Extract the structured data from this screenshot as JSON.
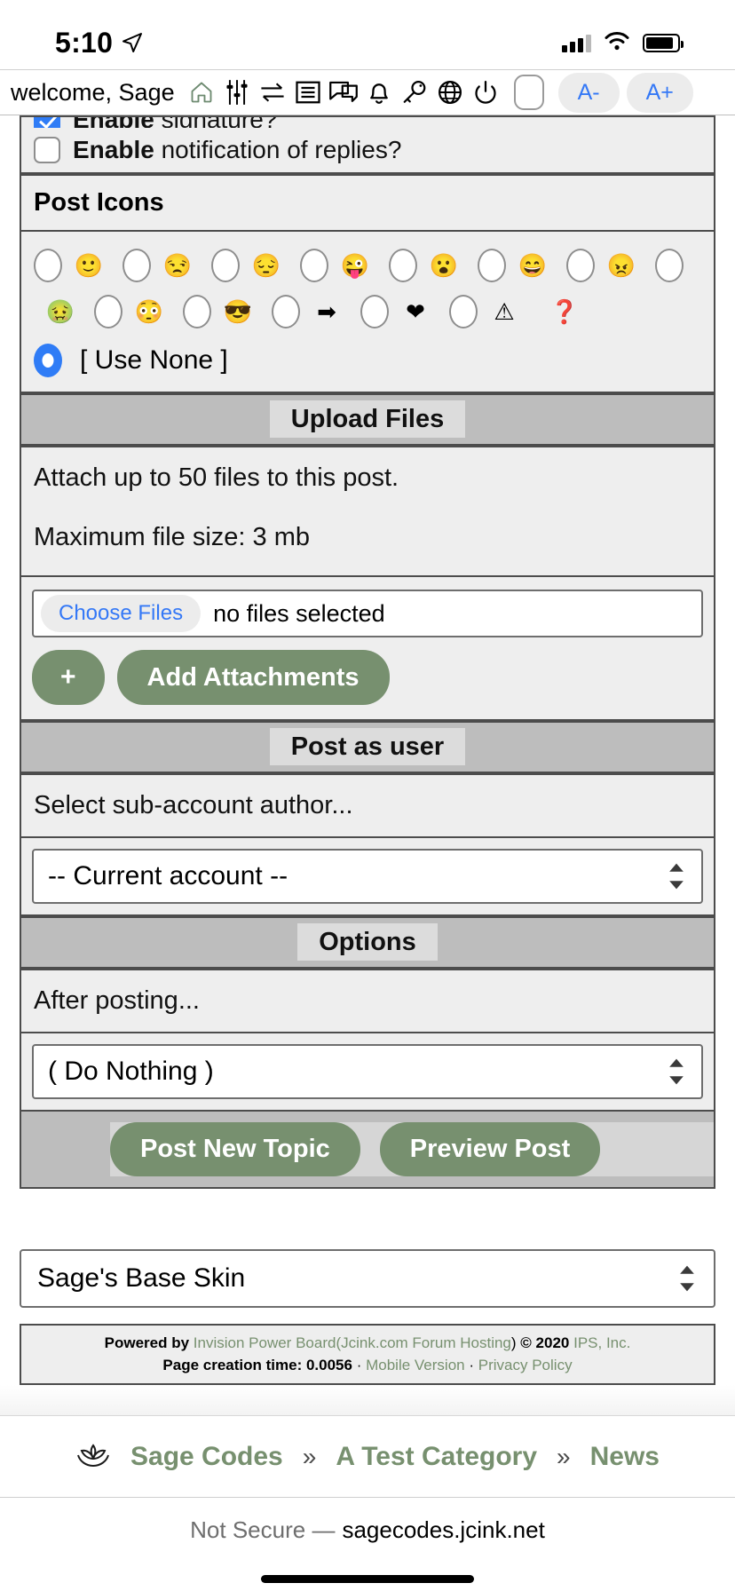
{
  "status_bar": {
    "time": "5:10",
    "location_icon": "location-arrow-icon",
    "signal_icon": "cellular-signal-icon",
    "wifi_icon": "wifi-icon",
    "battery_icon": "battery-icon"
  },
  "header": {
    "welcome": "welcome, Sage",
    "icons": [
      {
        "name": "home-icon"
      },
      {
        "name": "sliders-icon"
      },
      {
        "name": "transfer-arrows-icon"
      },
      {
        "name": "document-list-icon"
      },
      {
        "name": "chat-bubbles-icon"
      },
      {
        "name": "bell-icon"
      },
      {
        "name": "key-icon"
      },
      {
        "name": "globe-icon"
      },
      {
        "name": "power-icon"
      }
    ],
    "toggle_label": "",
    "font_decrease": "A-",
    "font_increase": "A+"
  },
  "form": {
    "enable_signature": {
      "label_bold": "Enable",
      "label_rest": " signature?",
      "checked": true
    },
    "enable_notification": {
      "label_bold": "Enable",
      "label_rest": " notification of replies?",
      "checked": false
    },
    "post_icons": {
      "title": "Post Icons",
      "items": [
        {
          "emoji": "🙂",
          "name": "smile-icon"
        },
        {
          "emoji": "😒",
          "name": "unimpressed-icon"
        },
        {
          "emoji": "😔",
          "name": "sad-icon"
        },
        {
          "emoji": "😜",
          "name": "tongue-icon"
        },
        {
          "emoji": "😮",
          "name": "surprised-icon"
        },
        {
          "emoji": "😄",
          "name": "laugh-icon"
        },
        {
          "emoji": "😠",
          "name": "angry-icon"
        },
        {
          "emoji": "🤢",
          "name": "sick-green-icon"
        },
        {
          "emoji": "😳",
          "name": "shocked-icon"
        },
        {
          "emoji": "😎",
          "name": "sunglasses-icon"
        },
        {
          "emoji": "➡",
          "name": "arrow-icon"
        },
        {
          "emoji": "❤",
          "name": "heart-icon"
        },
        {
          "emoji": "⚠",
          "name": "exclamation-icon"
        },
        {
          "emoji": "❓",
          "name": "question-icon"
        }
      ],
      "use_none_label": "[ Use None ]",
      "use_none_selected": true
    },
    "upload": {
      "title": "Upload Files",
      "line1": "Attach up to 50 files to this post.",
      "line2": "Maximum file size: 3 mb",
      "choose_files_label": "Choose Files",
      "no_files_text": "no files selected",
      "plus_label": "+",
      "add_attachments_label": "Add Attachments"
    },
    "post_as_user": {
      "title": "Post as user",
      "description": "Select sub-account author...",
      "selected": "-- Current account --"
    },
    "options": {
      "title": "Options",
      "description": "After posting...",
      "selected": "( Do Nothing )"
    },
    "submit": {
      "post_new_topic": "Post New Topic",
      "preview_post": "Preview Post"
    }
  },
  "skin_selector": {
    "selected": "Sage's Base Skin"
  },
  "footer": {
    "powered_by": "Powered by",
    "ipb": "Invision Power Board",
    "open_paren": "(",
    "jcink": "Jcink.com Forum Hosting",
    "close_paren": ")",
    "copyright": "© 2020",
    "ips": "IPS, Inc.",
    "page_creation": "Page creation time: 0.0056",
    "dot1": "·",
    "mobile_version": "Mobile Version",
    "dot2": "·",
    "privacy_policy": "Privacy Policy"
  },
  "breadcrumb": {
    "logo_icon": "lotus-icon",
    "items": [
      "Sage Codes",
      "A Test Category",
      "News"
    ],
    "separator": "»"
  },
  "url_bar": {
    "security": "Not Secure —",
    "host": "sagecodes.jcink.net"
  },
  "colors": {
    "accent_green": "#77906f",
    "panel_bg": "#eeeeee",
    "title_bar": "#bdbdbd",
    "title_chip": "#dcdcdc",
    "border": "#4c4c4c",
    "link_blue": "#3478f6"
  }
}
